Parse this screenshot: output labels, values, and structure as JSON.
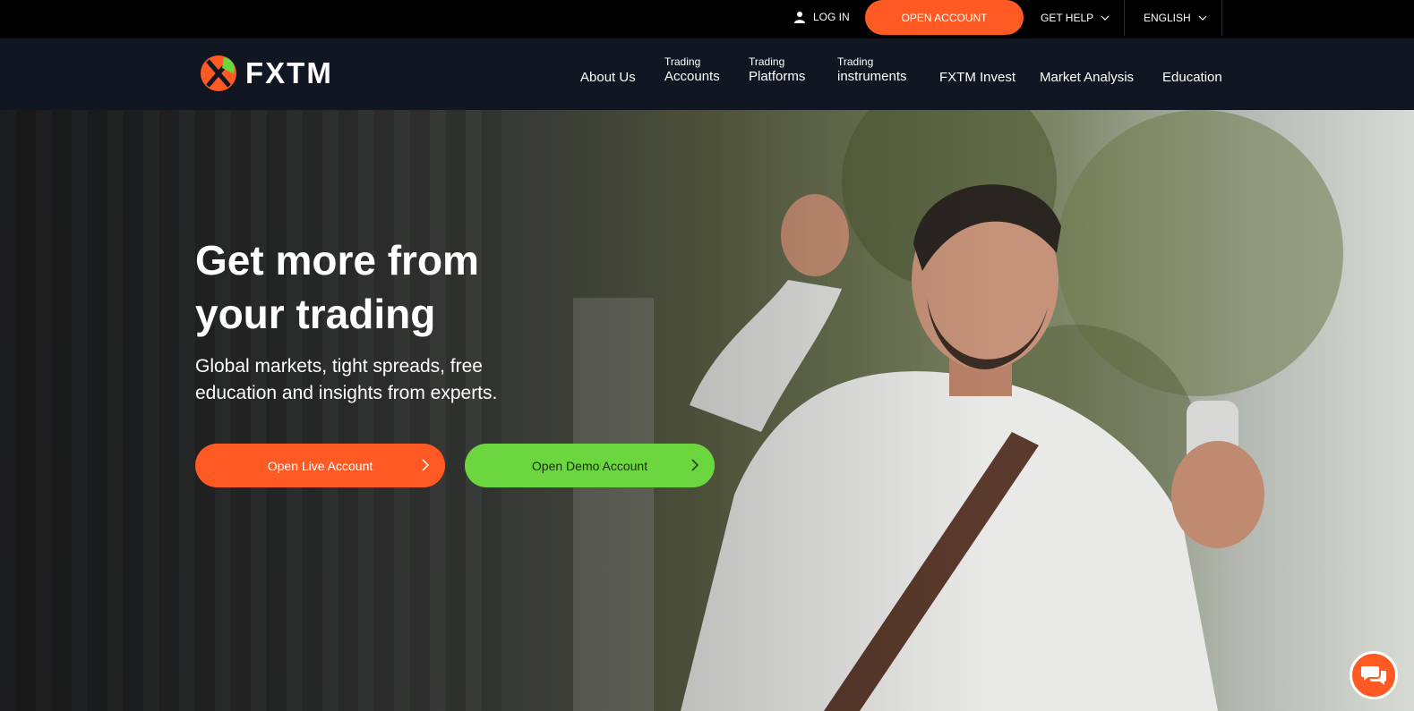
{
  "topbar": {
    "login_label": "LOG IN",
    "open_account_label": "OPEN ACCOUNT",
    "help_label": "GET HELP",
    "language_label": "ENGLISH"
  },
  "nav": {
    "logo_text": "FXTM",
    "items": [
      {
        "small": "",
        "label": "About Us"
      },
      {
        "small": "Trading",
        "label": "Accounts"
      },
      {
        "small": "Trading",
        "label": "Platforms"
      },
      {
        "small": "Trading",
        "label": "instruments"
      },
      {
        "small": "",
        "label": "FXTM Invest"
      },
      {
        "small": "",
        "label": "Market Analysis"
      },
      {
        "small": "",
        "label": "Education"
      }
    ]
  },
  "hero": {
    "title_line1": "Get more from",
    "title_line2": "your trading",
    "subtitle_line1": "Global markets, tight spreads, free",
    "subtitle_line2": "education and insights from experts.",
    "live_button_label": "Open Live Account",
    "demo_button_label": "Open Demo Account"
  },
  "colors": {
    "accent": "#ff5a23",
    "green": "#6cd63e",
    "nav_bg": "#111722",
    "topbar_bg": "#000000"
  },
  "icons": {
    "login": "user-icon",
    "chevron": "chevron-down-icon",
    "arrow": "chevron-right-icon",
    "chat": "chat-bubbles-icon"
  }
}
